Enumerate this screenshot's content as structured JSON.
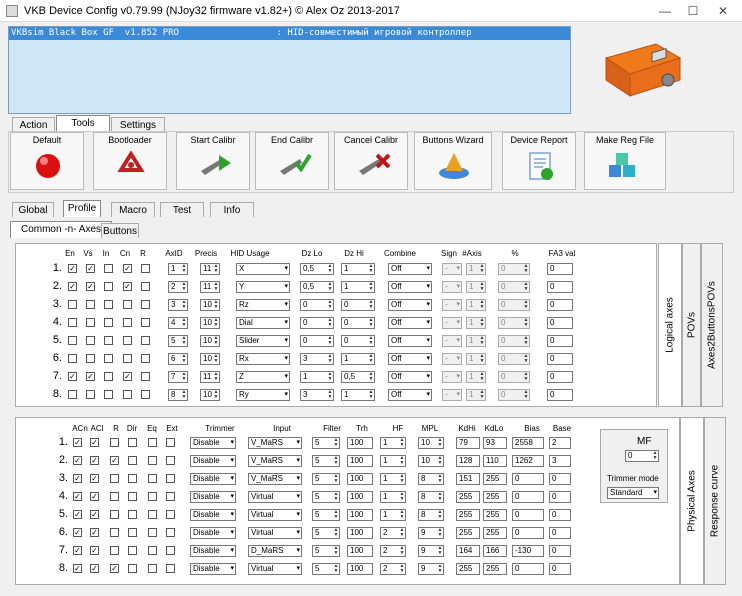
{
  "window": {
    "title": "VKB Device Config v0.79.99 (NJoy32 firmware v1.82+) © Alex Oz 2013-2017",
    "min": "—",
    "max": "☐",
    "close": "✕"
  },
  "console": {
    "line": "VKBsim Black Box GF  v1.852 PRO                  : HID-совместимый игровой контроллер"
  },
  "main_tabs": [
    {
      "label": "Action"
    },
    {
      "label": "Tools"
    },
    {
      "label": "Settings"
    }
  ],
  "toolbar": [
    {
      "label": "Default",
      "icon": "red-ball-icon"
    },
    {
      "label": "Bootloader",
      "icon": "recycle-icon"
    },
    {
      "label": "Start Calibr",
      "icon": "caliper-play-icon"
    },
    {
      "label": "End Calibr",
      "icon": "caliper-check-icon"
    },
    {
      "label": "Cancel Calibr",
      "icon": "caliper-cancel-icon"
    },
    {
      "label": "Buttons Wizard",
      "icon": "wizard-hat-icon"
    },
    {
      "label": "Device Report",
      "icon": "report-icon"
    },
    {
      "label": "Make Reg File",
      "icon": "registry-cubes-icon"
    }
  ],
  "sub_tabs": [
    {
      "label": "Global"
    },
    {
      "label": "Profile"
    },
    {
      "label": "Macro"
    },
    {
      "label": "Test"
    },
    {
      "label": "Info"
    }
  ],
  "profile_tabs": [
    {
      "label": "Common -n- Axes"
    },
    {
      "label": "Buttons"
    }
  ],
  "logical": {
    "headers": [
      "En",
      "Vs",
      "In",
      "Cn",
      "R",
      "AxID",
      "Precis",
      "HID Usage",
      "Dz Lo",
      "Dz Hi",
      "Combine",
      "Sign",
      "#Axis",
      "%",
      "FA3 val"
    ],
    "rows": [
      {
        "n": "1.",
        "checks": [
          true,
          true,
          false,
          true,
          false
        ],
        "axid": "1",
        "precis": "11",
        "usage": "X",
        "dzlo": "0,5",
        "dzhi": "1",
        "combine": "Off",
        "sign": "-",
        "naxis": "1",
        "pct": "0",
        "fa3": "0"
      },
      {
        "n": "2.",
        "checks": [
          true,
          true,
          false,
          true,
          false
        ],
        "axid": "2",
        "precis": "11",
        "usage": "Y",
        "dzlo": "0,5",
        "dzhi": "1",
        "combine": "Off",
        "sign": "-",
        "naxis": "1",
        "pct": "0",
        "fa3": "0"
      },
      {
        "n": "3.",
        "checks": [
          false,
          false,
          false,
          false,
          false
        ],
        "axid": "3",
        "precis": "10",
        "usage": "Rz",
        "dzlo": "0",
        "dzhi": "0",
        "combine": "Off",
        "sign": "-",
        "naxis": "1",
        "pct": "0",
        "fa3": "0"
      },
      {
        "n": "4.",
        "checks": [
          false,
          false,
          false,
          false,
          false
        ],
        "axid": "4",
        "precis": "10",
        "usage": "Dial",
        "dzlo": "0",
        "dzhi": "0",
        "combine": "Off",
        "sign": "-",
        "naxis": "1",
        "pct": "0",
        "fa3": "0"
      },
      {
        "n": "5.",
        "checks": [
          false,
          false,
          false,
          false,
          false
        ],
        "axid": "5",
        "precis": "10",
        "usage": "Slider",
        "dzlo": "0",
        "dzhi": "0",
        "combine": "Off",
        "sign": "-",
        "naxis": "1",
        "pct": "0",
        "fa3": "0"
      },
      {
        "n": "6.",
        "checks": [
          false,
          false,
          false,
          false,
          false
        ],
        "axid": "6",
        "precis": "10",
        "usage": "Rx",
        "dzlo": "3",
        "dzhi": "1",
        "combine": "Off",
        "sign": "-",
        "naxis": "1",
        "pct": "0",
        "fa3": "0"
      },
      {
        "n": "7.",
        "checks": [
          true,
          true,
          false,
          true,
          false
        ],
        "axid": "7",
        "precis": "11",
        "usage": "Z",
        "dzlo": "1",
        "dzhi": "0,5",
        "combine": "Off",
        "sign": "-",
        "naxis": "1",
        "pct": "0",
        "fa3": "0"
      },
      {
        "n": "8.",
        "checks": [
          false,
          false,
          false,
          false,
          false
        ],
        "axid": "8",
        "precis": "10",
        "usage": "Ry",
        "dzlo": "3",
        "dzhi": "1",
        "combine": "Off",
        "sign": "-",
        "naxis": "1",
        "pct": "0",
        "fa3": "0"
      }
    ]
  },
  "physical": {
    "headers": [
      "ACn",
      "ACl",
      "R",
      "Dir",
      "Eq",
      "Ext",
      "Trimmer",
      "Input",
      "Filter",
      "Trh",
      "HF",
      "MPL",
      "KdHi",
      "KdLo",
      "Bias",
      "Base"
    ],
    "rows": [
      {
        "n": "1.",
        "checks": [
          true,
          true,
          false,
          false,
          false,
          false
        ],
        "trimmer": "Disable",
        "input": "V_MaRS",
        "filter": "5",
        "trh": "100",
        "hf": "1",
        "mpl": "10",
        "kdhi": "79",
        "kdlo": "93",
        "bias": "2558",
        "base": "2"
      },
      {
        "n": "2.",
        "checks": [
          true,
          true,
          true,
          false,
          false,
          false
        ],
        "trimmer": "Disable",
        "input": "V_MaRS",
        "filter": "5",
        "trh": "100",
        "hf": "1",
        "mpl": "10",
        "kdhi": "128",
        "kdlo": "110",
        "bias": "1262",
        "base": "3"
      },
      {
        "n": "3.",
        "checks": [
          true,
          true,
          false,
          false,
          false,
          false
        ],
        "trimmer": "Disable",
        "input": "V_MaRS",
        "filter": "5",
        "trh": "100",
        "hf": "1",
        "mpl": "8",
        "kdhi": "151",
        "kdlo": "255",
        "bias": "0",
        "base": "0"
      },
      {
        "n": "4.",
        "checks": [
          true,
          true,
          false,
          false,
          false,
          false
        ],
        "trimmer": "Disable",
        "input": "Virtual",
        "filter": "5",
        "trh": "100",
        "hf": "1",
        "mpl": "8",
        "kdhi": "255",
        "kdlo": "255",
        "bias": "0",
        "base": "0"
      },
      {
        "n": "5.",
        "checks": [
          true,
          true,
          false,
          false,
          false,
          false
        ],
        "trimmer": "Disable",
        "input": "Virtual",
        "filter": "5",
        "trh": "100",
        "hf": "1",
        "mpl": "8",
        "kdhi": "255",
        "kdlo": "255",
        "bias": "0",
        "base": "0"
      },
      {
        "n": "6.",
        "checks": [
          true,
          true,
          false,
          false,
          false,
          false
        ],
        "trimmer": "Disable",
        "input": "Virtual",
        "filter": "5",
        "trh": "100",
        "hf": "2",
        "mpl": "9",
        "kdhi": "255",
        "kdlo": "255",
        "bias": "0",
        "base": "0"
      },
      {
        "n": "7.",
        "checks": [
          true,
          true,
          false,
          false,
          false,
          false
        ],
        "trimmer": "Disable",
        "input": "D_MaRS",
        "filter": "5",
        "trh": "100",
        "hf": "2",
        "mpl": "9",
        "kdhi": "164",
        "kdlo": "166",
        "bias": "-130",
        "base": "0"
      },
      {
        "n": "8.",
        "checks": [
          true,
          true,
          true,
          false,
          false,
          false
        ],
        "trimmer": "Disable",
        "input": "Virtual",
        "filter": "5",
        "trh": "100",
        "hf": "2",
        "mpl": "9",
        "kdhi": "255",
        "kdlo": "255",
        "bias": "0",
        "base": "0"
      }
    ]
  },
  "mf_box": {
    "label": "MF",
    "value": "0",
    "trimmer_label": "Trimmer mode",
    "trimmer_value": "Standard"
  },
  "side_tabs": {
    "logical": "Logical axes",
    "povs": "POVs",
    "axes2buttons": "Axes2ButtonsPOVs",
    "physical": "Physical Axes",
    "response": "Response curve"
  }
}
